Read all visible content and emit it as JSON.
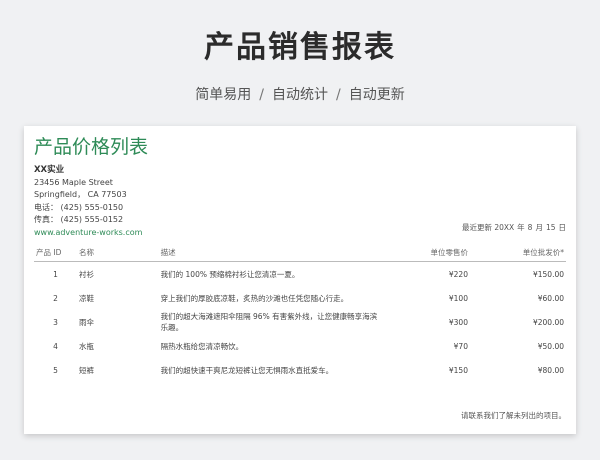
{
  "hero": {
    "title": "产品销售报表",
    "tags": [
      "简单易用",
      "自动统计",
      "自动更新"
    ],
    "separator": "/"
  },
  "sheet": {
    "title": "产品价格列表",
    "company": {
      "name": "XX实业",
      "street": "23456 Maple Street",
      "city": "Springfield， CA 77503",
      "phone": "电话：  (425) 555-0150",
      "fax": "传真：  (425) 555-0152",
      "website": "www.adventure-works.com"
    },
    "updated": {
      "label": "最近更新 20XX",
      "year_suffix": "年",
      "month": "8",
      "month_suffix": "月",
      "day": "15",
      "day_suffix": "日"
    },
    "columns": [
      "产品 ID",
      "名称",
      "描述",
      "单位零售价",
      "单位批发价*"
    ],
    "rows": [
      {
        "id": "1",
        "name": "衬衫",
        "desc": "我们的 100% 预缩棉衬衫让您清凉一夏。",
        "retail": "¥220",
        "wholesale": "¥150.00"
      },
      {
        "id": "2",
        "name": "凉鞋",
        "desc": "穿上我们的厚胶底凉鞋，炙热的沙滩也任凭您随心行走。",
        "retail": "¥100",
        "wholesale": "¥60.00"
      },
      {
        "id": "3",
        "name": "雨伞",
        "desc": "我们的超大海滩遮阳伞阻隔 96% 有害紫外线，让您健康畅享海滨乐趣。",
        "retail": "¥300",
        "wholesale": "¥200.00"
      },
      {
        "id": "4",
        "name": "水瓶",
        "desc": "隔热水瓶给您清凉畅饮。",
        "retail": "¥70",
        "wholesale": "¥50.00"
      },
      {
        "id": "5",
        "name": "短裤",
        "desc": "我们的超快速干爽尼龙短裤让您无惧雨水直抵爱车。",
        "retail": "¥150",
        "wholesale": "¥80.00"
      }
    ],
    "footer": "请联系我们了解未列出的项目。"
  }
}
